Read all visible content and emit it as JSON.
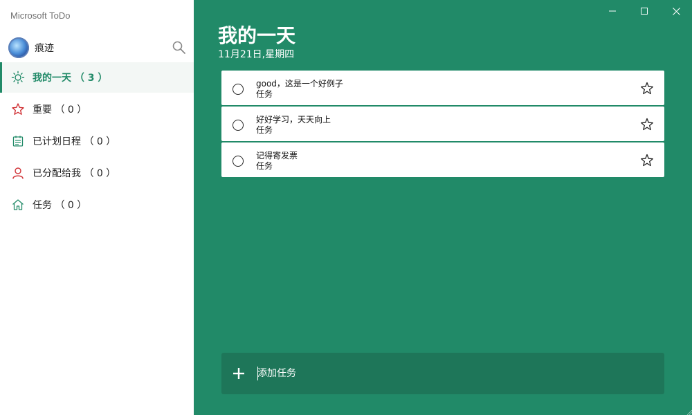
{
  "app": {
    "title": "Microsoft ToDo"
  },
  "user": {
    "name": "痕迹"
  },
  "sidebar": {
    "items": [
      {
        "label": "我的一天 （ 3 ）",
        "icon": "sun-icon",
        "active": true
      },
      {
        "label": "重要 （ 0 ）",
        "icon": "star-icon",
        "active": false
      },
      {
        "label": "已计划日程 （ 0 ）",
        "icon": "calendar-icon",
        "active": false
      },
      {
        "label": "已分配给我 （ 0 ）",
        "icon": "person-icon",
        "active": false
      },
      {
        "label": "任务 （ 0 ）",
        "icon": "home-icon",
        "active": false
      }
    ]
  },
  "main": {
    "title": "我的一天",
    "date": "11月21日,星期四",
    "tasks": [
      {
        "title": "good，这是一个好例子",
        "list": "任务",
        "completed": false,
        "starred": false
      },
      {
        "title": "好好学习，天天向上",
        "list": "任务",
        "completed": false,
        "starred": false
      },
      {
        "title": "记得寄发票",
        "list": "任务",
        "completed": false,
        "starred": false
      }
    ],
    "add_task": {
      "placeholder": "添加任务"
    }
  },
  "colors": {
    "accent": "#218a68",
    "accent_dark": "#1e7659",
    "important_red": "#d13438",
    "sidebar_bg": "#ffffff"
  }
}
